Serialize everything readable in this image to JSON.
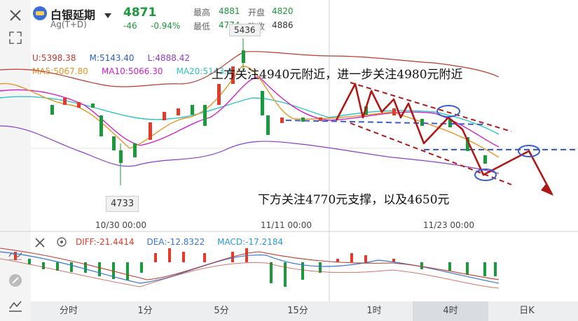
{
  "header": {
    "title": "白银延期",
    "subtitle": "Ag(T+D)",
    "price": "4871",
    "change": "-46",
    "change_pct": "-0.94%",
    "high_label": "最高",
    "high_value": "4881",
    "open_label": "开盘",
    "open_value": "4820",
    "low_label": "最低",
    "low_value": "4774",
    "prev_label": "昨收",
    "prev_value": "4886"
  },
  "indicators": {
    "boll_u": "U:5398.38",
    "boll_m": "M:5143.40",
    "boll_l": "L:4888.42",
    "ma5": "MA5:5067.80",
    "ma10": "MA10:5066.30",
    "ma20": "MA20:5143.4"
  },
  "macd": {
    "diff": "DIFF:-21.4414",
    "dea": "DEA:-12.8322",
    "macd": "MACD:-17.2184"
  },
  "chart": {
    "peak_label": "5436",
    "trough_label": "4733",
    "time_labels": [
      "10/30 00:00",
      "11/11 00:00",
      "11/23 00:00"
    ],
    "annotation_top": "上方关注4940元附近，进一步关注4980元附近",
    "annotation_bottom": "下方关注4770元支撑，以及4650元"
  },
  "tabs": [
    "分时",
    "1分",
    "5分",
    "15分",
    "1时",
    "4时",
    "日K"
  ],
  "active_tab": "4时",
  "colors": {
    "up": "#e23b2a",
    "down": "#1a9a3a",
    "boll": "#c0392b",
    "ma5": "#e69520",
    "ma10": "#d020c8",
    "ma20": "#2ec4c4",
    "boll_lower": "#8a3cc8",
    "annotation": "#b01818",
    "dashed_blue": "#3a5ccc"
  },
  "icons": [
    "close-icon",
    "logo-icon",
    "chevron-down-icon",
    "fullscreen-icon",
    "settings-icon",
    "draw-icon",
    "indicator-icon"
  ]
}
